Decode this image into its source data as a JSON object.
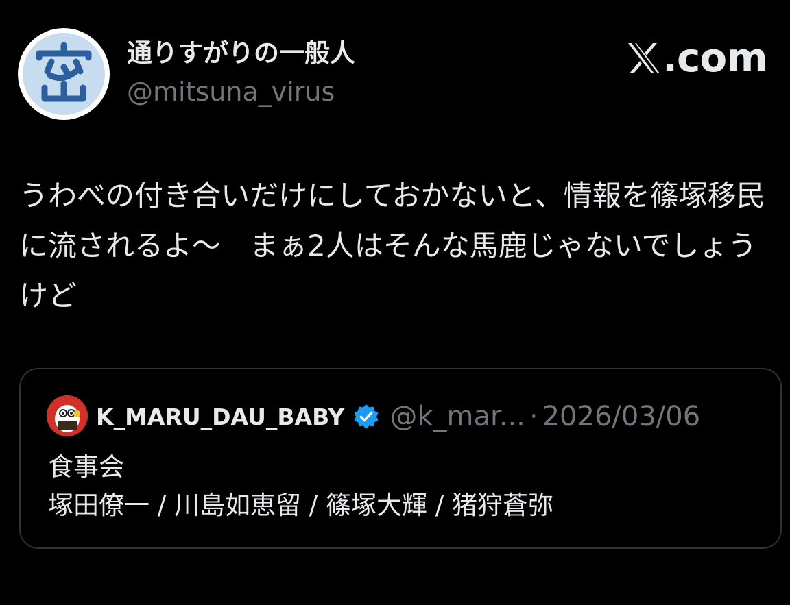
{
  "author": {
    "display_name": "通りすがりの一般人",
    "handle": "@mitsuna_virus",
    "avatar_glyph": "密",
    "avatar_color": "#2b5f9e"
  },
  "brand": {
    "x_glyph": "𝕏",
    "domain": ".com"
  },
  "tweet": {
    "text": "うわべの付き合いだけにしておかないと、情報を篠塚移民に流されるよ〜　まぁ2人はそんな馬鹿じゃないでしょうけど"
  },
  "quote": {
    "author_name": "K_MARU_DAU_BABY",
    "handle": "@k_mar...",
    "separator": "·",
    "date": "2026/03/06",
    "verified_color": "#1d9bf0",
    "line1": "食事会",
    "line2": "塚田僚一 / 川島如恵留 / 篠塚大輝 / 猪狩蒼弥"
  }
}
